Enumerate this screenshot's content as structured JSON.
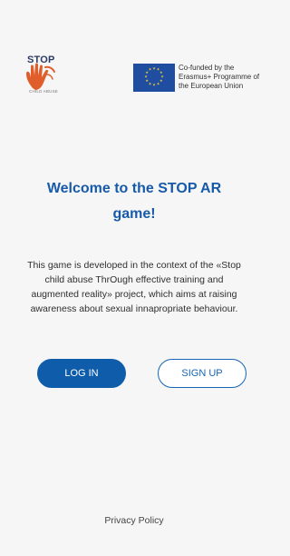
{
  "logo": {
    "top_text": "STOP",
    "bottom_text": "CHILD ABUSE",
    "hand_color": "#e05d2c"
  },
  "eu_badge": {
    "text": "Co-funded by the Erasmus+ Programme of the European Union",
    "flag_color": "#1f4ea1",
    "star_color": "#f5cd35"
  },
  "welcome": {
    "title": "Welcome to the STOP AR game!",
    "description": "This game is developed in the context of the «Stop child abuse ThrOugh effective training and augmented reality» project, which aims at raising awareness about sexual innapropriate behaviour."
  },
  "actions": {
    "login_label": "LOG IN",
    "signup_label": "SIGN UP"
  },
  "footer": {
    "privacy_label": "Privacy Policy"
  },
  "colors": {
    "primary": "#0f5daa",
    "title": "#175aa9",
    "background": "#f6f6f6"
  }
}
